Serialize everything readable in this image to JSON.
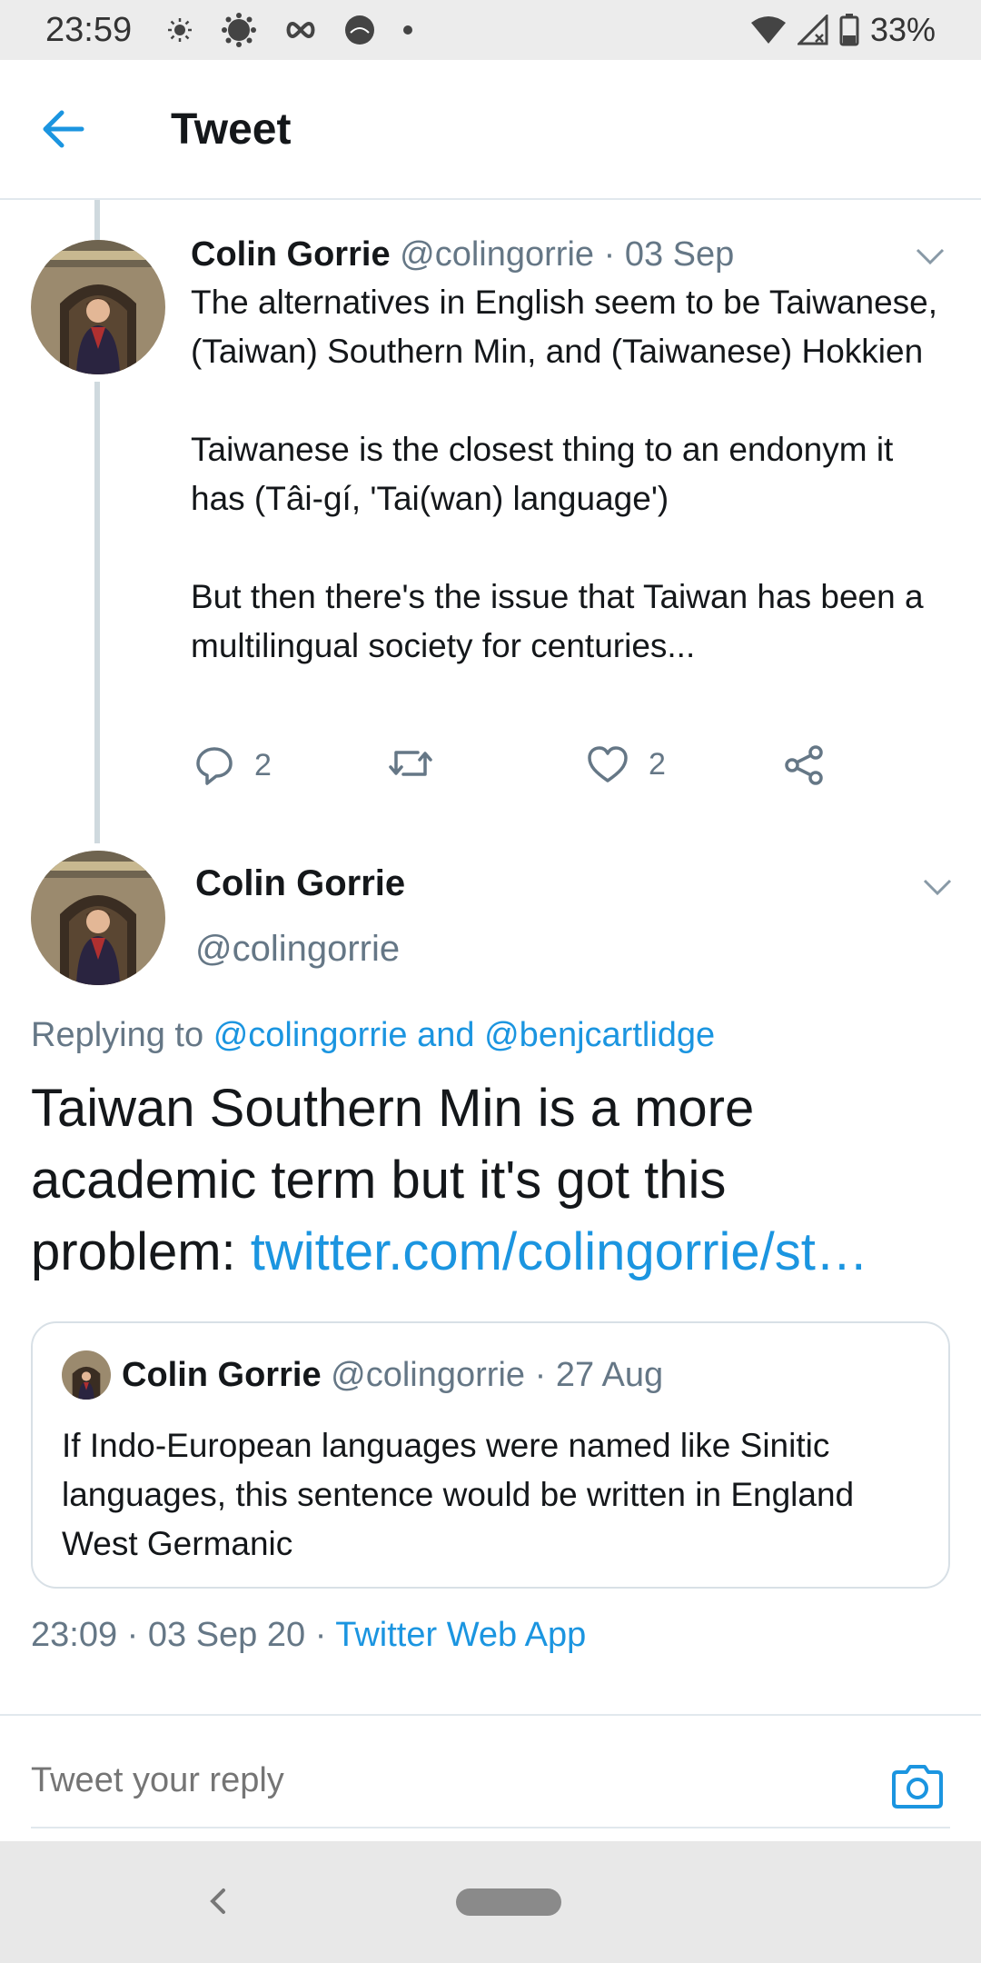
{
  "status_bar": {
    "time": "23:59",
    "battery": "33%",
    "icons": [
      "brightness-icon",
      "sun-icon",
      "infinity-icon",
      "lime-icon",
      "dot-icon",
      "wifi-icon",
      "signal-icon",
      "battery-icon"
    ]
  },
  "app_bar": {
    "title": "Tweet"
  },
  "parent_tweet": {
    "name": "Colin Gorrie",
    "handle": "@colingorrie",
    "separator": "·",
    "date": "03 Sep",
    "paragraphs": [
      "The alternatives in English seem to be Taiwanese, (Taiwan) Southern Min, and (Taiwanese) Hokkien",
      "Taiwanese is the closest thing to an endonym it has (Tâi-gí, 'Tai(wan) language')",
      "But then there's the issue that Taiwan has been a multilingual society for centuries..."
    ],
    "reply_count": "2",
    "like_count": "2"
  },
  "main_tweet": {
    "name": "Colin Gorrie",
    "handle": "@colingorrie",
    "replying_prefix": "Replying to",
    "replying_user1": "@colingorrie",
    "replying_and": "and",
    "replying_user2": "@benjcartlidge",
    "text_line1": "Taiwan Southern Min is a more",
    "text_line2": "academic term but it's got this",
    "text_line3_plain": "problem: ",
    "text_link": "twitter.com/colingorrie/st…",
    "time": "23:09",
    "separator": "·",
    "date": "03 Sep 20",
    "source": "Twitter Web App"
  },
  "quoted_tweet": {
    "name": "Colin Gorrie",
    "handle": "@colingorrie",
    "separator": "·",
    "date": "27 Aug",
    "text": "If Indo-European languages were named like Sinitic languages, this sentence would be written in England West Germanic"
  },
  "reply_bar": {
    "placeholder": "Tweet your reply"
  },
  "colors": {
    "accent": "#1b95e0",
    "muted": "#657786",
    "text": "#14171a"
  }
}
